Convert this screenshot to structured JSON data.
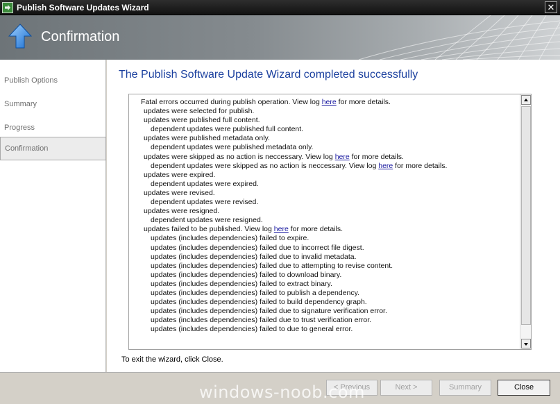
{
  "window": {
    "title": "Publish Software Updates Wizard",
    "close_glyph": "✕"
  },
  "banner": {
    "title": "Confirmation",
    "icon": "blue-up-arrow-icon"
  },
  "sidebar": {
    "items": [
      {
        "label": "Publish Options",
        "active": false
      },
      {
        "label": "Summary",
        "active": false
      },
      {
        "label": "Progress",
        "active": false
      },
      {
        "label": "Confirmation",
        "active": true
      }
    ]
  },
  "main": {
    "headline": "The Publish Software Update Wizard completed successfully",
    "log": {
      "lines": [
        {
          "pre": "Fatal errors occurred during publish operation. View log ",
          "link": "here",
          "post": " for more details."
        },
        {
          "text": "updates were selected for publish."
        },
        {
          "text": "updates were published full content."
        },
        {
          "text": "dependent updates were published full content."
        },
        {
          "text": "updates were published metadata only."
        },
        {
          "text": "dependent updates were published metadata only."
        },
        {
          "pre": "updates were skipped as no action is neccessary. View log ",
          "link": "here",
          "post": " for more details."
        },
        {
          "pre": "dependent updates were skipped as no action is neccessary. View log ",
          "link": "here",
          "post": " for more details."
        },
        {
          "text": "updates were expired."
        },
        {
          "text": "dependent updates were expired."
        },
        {
          "text": "updates were revised."
        },
        {
          "text": "dependent updates were revised."
        },
        {
          "text": "updates were resigned."
        },
        {
          "text": "dependent updates were resigned."
        },
        {
          "pre": "updates failed to be published. View log ",
          "link": "here",
          "post": " for more details."
        },
        {
          "text": "updates (includes dependencies) failed to expire."
        },
        {
          "text": "updates (includes dependencies) failed due to incorrect file digest."
        },
        {
          "text": "updates (includes dependencies) failed due to invalid metadata."
        },
        {
          "text": "updates (includes dependencies) failed due to attempting to revise content."
        },
        {
          "text": "updates (includes dependencies) failed to download binary."
        },
        {
          "text": "updates (includes dependencies) failed to extract binary."
        },
        {
          "text": "updates (includes dependencies) failed to publish a dependency."
        },
        {
          "text": "updates (includes dependencies) failed to build dependency graph."
        },
        {
          "text": "updates (includes dependencies) failed due to signature verification error."
        },
        {
          "text": "updates (includes dependencies) failed due to trust verification error."
        },
        {
          "text": "updates (includes dependencies) failed to due to general error."
        }
      ]
    },
    "exit_text": "To exit the wizard, click Close."
  },
  "footer": {
    "previous_label": "< Previous",
    "next_label": "Next >",
    "summary_label": "Summary",
    "close_label": "Close"
  },
  "watermark": "windows-noob.com",
  "colors": {
    "headline": "#1a3f9e",
    "link": "#1a1aa0",
    "banner_dark": "#6d7478",
    "banner_light": "#cfd2d4"
  }
}
